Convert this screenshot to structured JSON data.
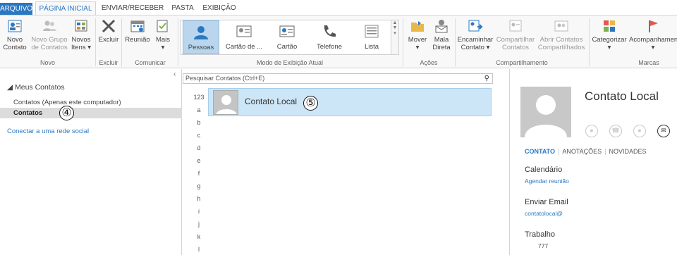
{
  "tabs": [
    "ARQUIVO",
    "PÁGINA INICIAL",
    "ENVIAR/RECEBER",
    "PASTA",
    "EXIBIÇÃO"
  ],
  "ribbon": {
    "novo": {
      "novo_contato": [
        "Novo",
        "Contato"
      ],
      "novo_grupo": [
        "Novo Grupo",
        "de Contatos"
      ],
      "novos_itens": [
        "Novos",
        "Itens ▾"
      ],
      "label": "Novo"
    },
    "excluir": {
      "button": "Excluir",
      "label": "Excluir"
    },
    "comunicar": {
      "reuniao": "Reunião",
      "mais": [
        "Mais",
        "▾"
      ],
      "label": "Comunicar"
    },
    "view": {
      "items": [
        "Pessoas",
        "Cartão de ...",
        "Cartão",
        "Telefone",
        "Lista"
      ],
      "label": "Modo de Exibição Atual"
    },
    "acoes": {
      "mover": [
        "Mover",
        "▾"
      ],
      "mala_direta": [
        "Mala",
        "Direta"
      ],
      "label": "Ações"
    },
    "compartilhamento": {
      "encaminhar": [
        "Encaminhar",
        "Contato ▾"
      ],
      "compartilhar": [
        "Compartilhar",
        "Contatos"
      ],
      "abrir": [
        "Abrir Contatos",
        "Compartilhados"
      ],
      "label": "Compartilhamento"
    },
    "marcas": {
      "categorizar": [
        "Categorizar",
        "▾"
      ],
      "acompanhamento": [
        "Acompanhamen",
        "▾"
      ],
      "label": "Marcas"
    }
  },
  "left": {
    "header": "◢ Meus Contatos",
    "items": [
      "Contatos (Apenas este computador)",
      "Contatos"
    ],
    "link": "Conectar a uma rede social",
    "badge": "④"
  },
  "middle": {
    "search_placeholder": "Pesquisar Contatos (Ctrl+E)",
    "alphabet": [
      "123",
      "a",
      "b",
      "c",
      "d",
      "e",
      "f",
      "g",
      "h",
      "i",
      "j",
      "k",
      "l"
    ],
    "contact_name": "Contato Local",
    "badge": "⑤"
  },
  "right": {
    "name": "Contato Local",
    "tabs": [
      "CONTATO",
      "ANOTAÇÕES",
      "NOVIDADES"
    ],
    "calendar_label": "Calendário",
    "calendar_link": "Agendar reunião",
    "email_label": "Enviar Email",
    "email_value": "contatolocal@",
    "work_label": "Trabalho",
    "work_value": "777"
  },
  "colors": {
    "accent": "#2b78c2",
    "selection": "#cde6f7",
    "view_selected": "#b9d6ee"
  }
}
